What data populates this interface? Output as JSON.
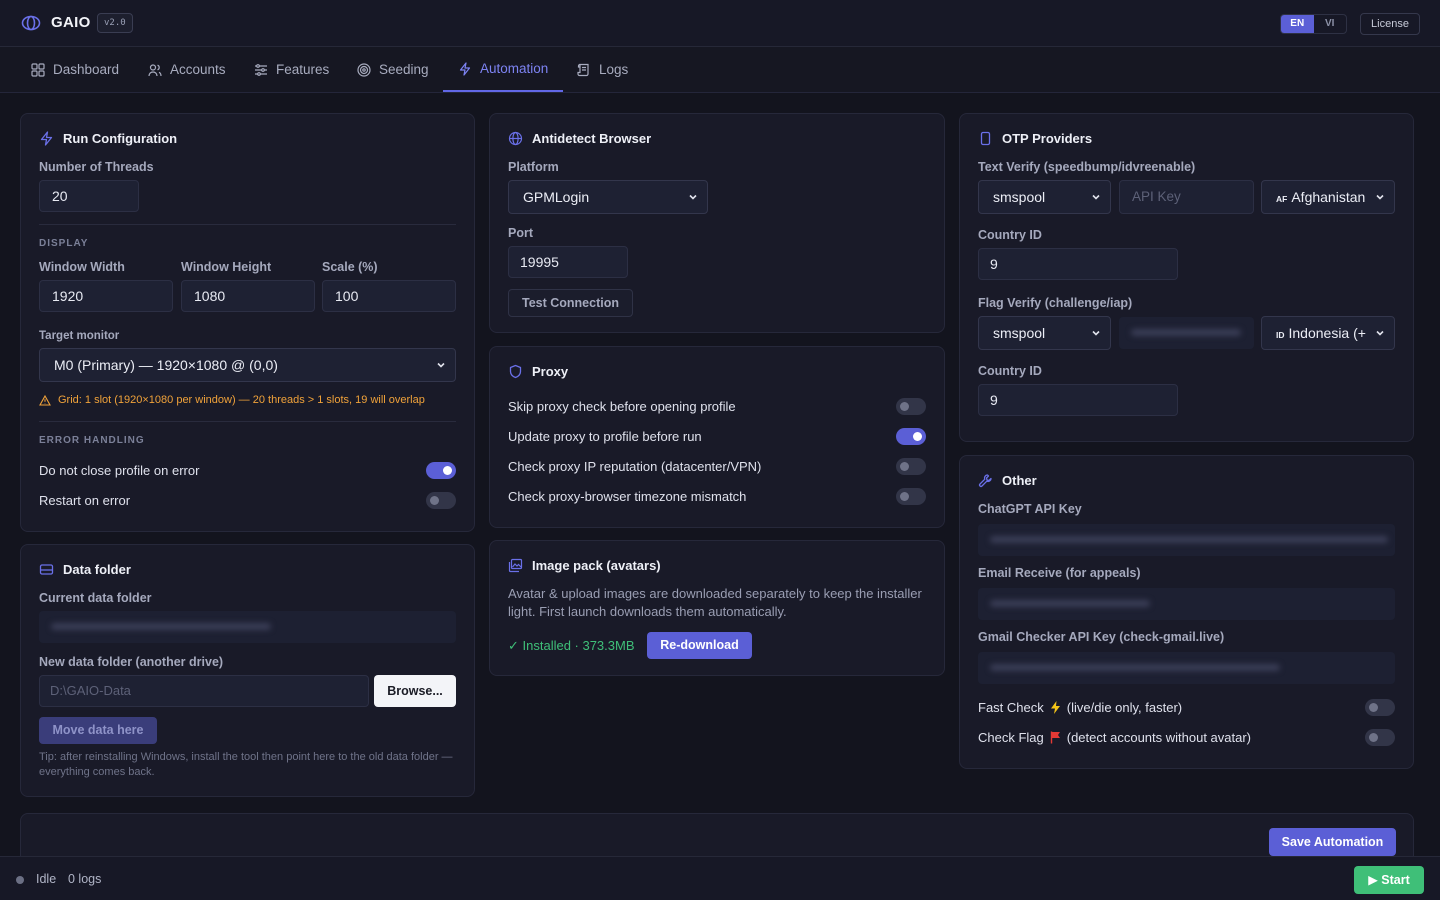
{
  "app": {
    "name": "GAIO",
    "version": "v2.0"
  },
  "header": {
    "lang_en": "EN",
    "lang_vi": "VI",
    "license": "License"
  },
  "nav": {
    "tabs": [
      {
        "label": "Dashboard",
        "icon": "grid-icon"
      },
      {
        "label": "Accounts",
        "icon": "users-icon"
      },
      {
        "label": "Features",
        "icon": "sliders-icon"
      },
      {
        "label": "Seeding",
        "icon": "target-icon"
      },
      {
        "label": "Automation",
        "icon": "lightning-icon"
      },
      {
        "label": "Logs",
        "icon": "scroll-icon"
      }
    ],
    "active": "Automation"
  },
  "run_config": {
    "title": "Run Configuration",
    "threads_label": "Number of Threads",
    "threads_value": "20",
    "display_section": "DISPLAY",
    "width_label": "Window Width",
    "width_value": "1920",
    "height_label": "Window Height",
    "height_value": "1080",
    "scale_label": "Scale (%)",
    "scale_value": "100",
    "monitor_label": "Target monitor",
    "monitor_value": "M0 (Primary) — 1920×1080 @ (0,0)",
    "warning": "Grid: 1 slot (1920×1080 per window) — 20 threads > 1 slots, 19 will overlap",
    "error_section": "ERROR HANDLING",
    "no_close_label": "Do not close profile on error",
    "no_close_on": true,
    "restart_label": "Restart on error",
    "restart_on": false
  },
  "data_folder": {
    "title": "Data folder",
    "current_label": "Current data folder",
    "new_label": "New data folder (another drive)",
    "new_placeholder": "D:\\GAIO-Data",
    "browse_button": "Browse...",
    "move_button": "Move data here",
    "tip": "Tip: after reinstalling Windows, install the tool then point here to the old data folder — everything comes back."
  },
  "antidetect": {
    "title": "Antidetect Browser",
    "platform_label": "Platform",
    "platform_value": "GPMLogin",
    "port_label": "Port",
    "port_value": "19995",
    "test_button": "Test Connection"
  },
  "proxy": {
    "title": "Proxy",
    "options": [
      {
        "label": "Skip proxy check before opening profile",
        "on": false
      },
      {
        "label": "Update proxy to profile before run",
        "on": true
      },
      {
        "label": "Check proxy IP reputation (datacenter/VPN)",
        "on": false
      },
      {
        "label": "Check proxy-browser timezone mismatch",
        "on": false
      }
    ]
  },
  "image_pack": {
    "title": "Image pack (avatars)",
    "description": "Avatar & upload images are downloaded separately to keep the installer light. First launch downloads them automatically.",
    "status": "✓ Installed · 373.3MB",
    "redownload_button": "Re-download"
  },
  "otp": {
    "title": "OTP Providers",
    "text_verify_label": "Text Verify (speedbump/idvreenable)",
    "text_provider": "smspool",
    "api_key_placeholder": "API Key",
    "text_country_code": "AF",
    "text_country": "Afghanistan",
    "country_id_label": "Country ID",
    "text_country_id": "9",
    "flag_verify_label": "Flag Verify (challenge/iap)",
    "flag_provider": "smspool",
    "flag_country_code": "ID",
    "flag_country": "Indonesia (+",
    "flag_country_id_label": "Country ID",
    "flag_country_id": "9"
  },
  "other": {
    "title": "Other",
    "chatgpt_label": "ChatGPT API Key",
    "email_label": "Email Receive (for appeals)",
    "gmail_label": "Gmail Checker API Key (check-gmail.live)",
    "fast_check_label": "Fast Check",
    "fast_check_note": "(live/die only, faster)",
    "fast_check_on": false,
    "check_flag_label": "Check Flag",
    "check_flag_note": "(detect accounts without avatar)",
    "check_flag_on": false
  },
  "footer": {
    "save_button": "Save Automation",
    "status": "Idle",
    "logs": "0 logs",
    "start_button": "▶ Start"
  },
  "colors": {
    "background": "#13141e",
    "card": "#191a28",
    "accent": "#5b5fd6",
    "warning": "#f0a23a",
    "success": "#3fbf78",
    "flag_red": "#e53935",
    "lightning_yellow": "#f5c518"
  }
}
